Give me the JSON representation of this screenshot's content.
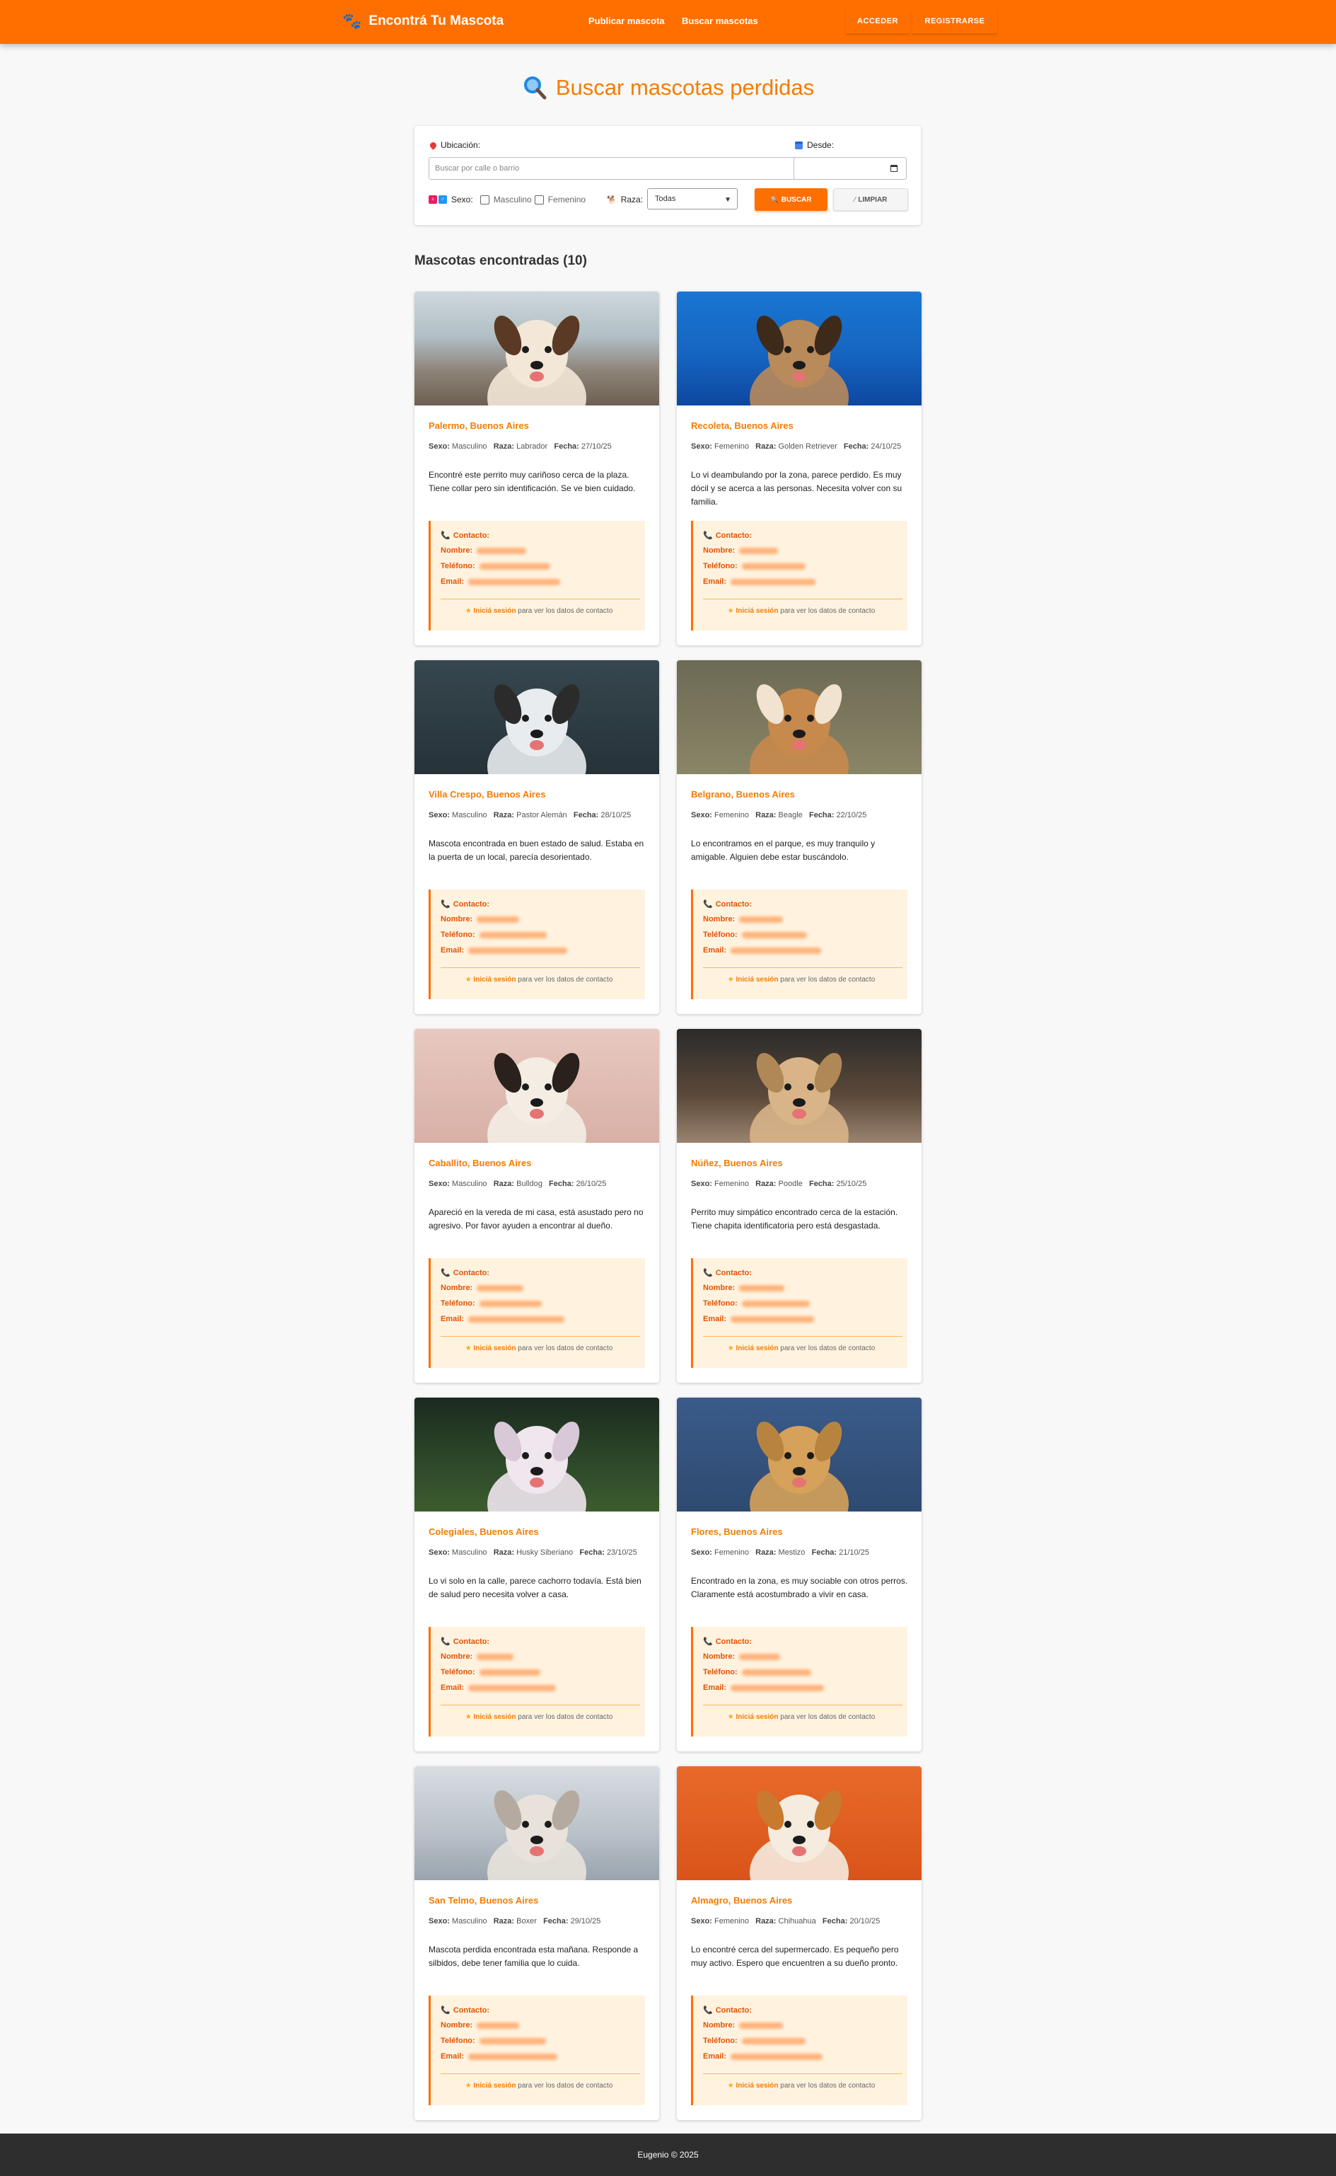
{
  "header": {
    "brand_icon": "paw-icon",
    "brand": "Encontrá Tu Mascota",
    "nav": [
      "Publicar mascota",
      "Buscar mascotas"
    ],
    "login": "ACCEDER",
    "register": "REGISTRARSE"
  },
  "page": {
    "title_icon": "magnifier-icon",
    "title": "Buscar mascotas perdidas"
  },
  "filters": {
    "location_label": "Ubicación:",
    "location_placeholder": "Buscar por calle o barrio",
    "date_label": "Desde:",
    "sex_label": "Sexo:",
    "sex_options": [
      "Masculino",
      "Femenino"
    ],
    "breed_label": "Raza:",
    "breed_selected": "Todas",
    "search_button": "BUSCAR",
    "clear_button": "LIMPIAR"
  },
  "results": {
    "title": "Mascotas encontradas (10)"
  },
  "labels": {
    "sex": "Sexo:",
    "breed": "Raza:",
    "date": "Fecha:",
    "contact": "Contacto:",
    "name": "Nombre:",
    "phone": "Teléfono:",
    "email": "Email:",
    "login_link": "Iniciá sesión",
    "login_suffix": "para ver los datos de contacto"
  },
  "pets": [
    {
      "location": "Palermo, Buenos Aires",
      "sex": "Masculino",
      "breed": "Labrador",
      "date": "27/10/25",
      "description": "Encontré este perrito muy cariñoso cerca de la plaza. Tiene collar pero sin identificación. Se ve bien cuidado."
    },
    {
      "location": "Recoleta, Buenos Aires",
      "sex": "Femenino",
      "breed": "Golden Retriever",
      "date": "24/10/25",
      "description": "Lo vi deambulando por la zona, parece perdido. Es muy dócil y se acerca a las personas. Necesita volver con su familia."
    },
    {
      "location": "Villa Crespo, Buenos Aires",
      "sex": "Masculino",
      "breed": "Pastor Alemán",
      "date": "28/10/25",
      "description": "Mascota encontrada en buen estado de salud. Estaba en la puerta de un local, parecía desorientado."
    },
    {
      "location": "Belgrano, Buenos Aires",
      "sex": "Femenino",
      "breed": "Beagle",
      "date": "22/10/25",
      "description": "Lo encontramos en el parque, es muy tranquilo y amigable. Alguien debe estar buscándolo."
    },
    {
      "location": "Caballito, Buenos Aires",
      "sex": "Masculino",
      "breed": "Bulldog",
      "date": "26/10/25",
      "description": "Apareció en la vereda de mi casa, está asustado pero no agresivo. Por favor ayuden a encontrar al dueño."
    },
    {
      "location": "Núñez, Buenos Aires",
      "sex": "Femenino",
      "breed": "Poodle",
      "date": "25/10/25",
      "description": "Perrito muy simpático encontrado cerca de la estación. Tiene chapita identificatoria pero está desgastada."
    },
    {
      "location": "Colegiales, Buenos Aires",
      "sex": "Masculino",
      "breed": "Husky Siberiano",
      "date": "23/10/25",
      "description": "Lo vi solo en la calle, parece cachorro todavía. Está bien de salud pero necesita volver a casa."
    },
    {
      "location": "Flores, Buenos Aires",
      "sex": "Femenino",
      "breed": "Mestizo",
      "date": "21/10/25",
      "description": "Encontrado en la zona, es muy sociable con otros perros. Claramente está acostumbrado a vivir en casa."
    },
    {
      "location": "San Telmo, Buenos Aires",
      "sex": "Masculino",
      "breed": "Boxer",
      "date": "29/10/25",
      "description": "Mascota perdida encontrada esta mañana. Responde a silbidos, debe tener familia que lo cuida."
    },
    {
      "location": "Almagro, Buenos Aires",
      "sex": "Femenino",
      "breed": "Chihuahua",
      "date": "20/10/25",
      "description": "Lo encontré cerca del supermercado. Es pequeño pero muy activo. Espero que encuentren a su dueño pronto."
    }
  ],
  "footer": {
    "text": "Eugenio © 2025"
  },
  "colors": {
    "primary": "#ff6f00",
    "accent_text": "#f57c00",
    "contact_bg": "#fff3e0",
    "footer_bg": "#2e2e2e"
  }
}
